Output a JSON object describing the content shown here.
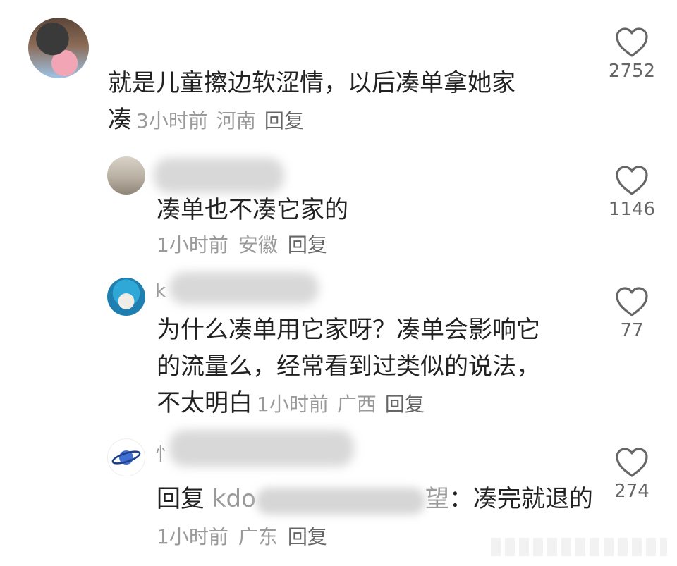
{
  "comments": [
    {
      "text_lines": [
        "就是儿童擦边软涩情，以后凑单拿她家",
        "凑"
      ],
      "time": "3小时前",
      "location": "河南",
      "reply": "回复",
      "likes": "2752"
    },
    {
      "name_prefix": "",
      "text": "凑单也不凑它家的",
      "time": "1小时前",
      "location": "安徽",
      "reply": "回复",
      "likes": "1146"
    },
    {
      "name_prefix": "k",
      "text_lines": [
        "为什么凑单用它家呀？凑单会影响它",
        "的流量么，经常看到过类似的说法，",
        "不太明白"
      ],
      "time": "1小时前",
      "location": "广西",
      "reply": "回复",
      "likes": "77"
    },
    {
      "name_prefix": "忄",
      "reply_prefix": "回复",
      "reply_target_start": "kdo",
      "reply_target_end": "望",
      "reply_text": "：凑完就退的",
      "time": "1小时前",
      "location": "广东",
      "reply": "回复",
      "likes": "274"
    }
  ],
  "icons": {
    "like": "heart-outline-icon"
  },
  "colors": {
    "text": "#222222",
    "meta": "#9a9a9a",
    "icon": "#666666"
  }
}
